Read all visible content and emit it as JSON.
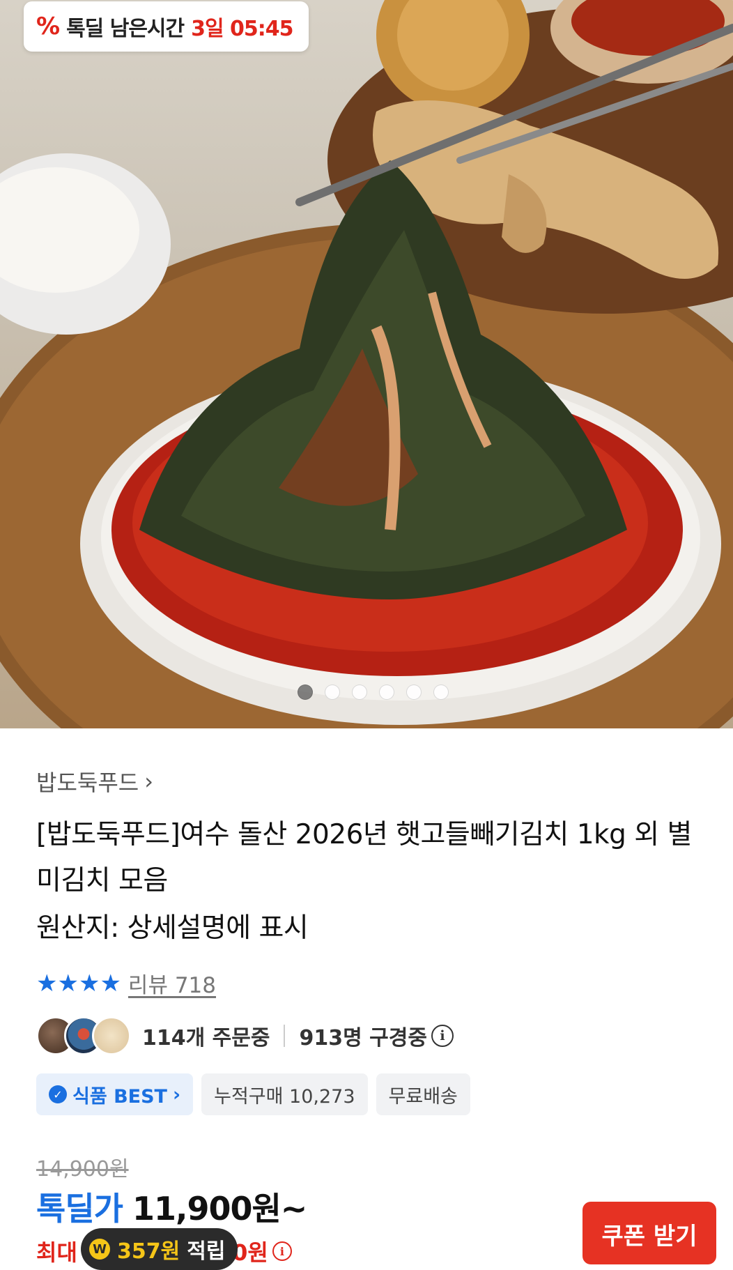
{
  "hero": {
    "timer": {
      "icon": "percent-tag-icon",
      "label": "톡딜 남은시간",
      "value": "3일 05:45"
    },
    "carousel": {
      "count": 6,
      "active": 0
    }
  },
  "product": {
    "seller": "밥도둑푸드",
    "title": "[밥도둑푸드]여수 돌산 2026년 햇고들빼기김치 1kg 외 별미김치 모음",
    "origin": "원산지: 상세설명에 표시",
    "rating": {
      "stars": 4,
      "review_text": "리뷰 718"
    },
    "social": {
      "orders": "114개 주문중",
      "viewers": "913명 구경중"
    },
    "badges": {
      "best": "식품 BEST",
      "cumulative": "누적구매 10,273",
      "shipping": "무료배송"
    },
    "price": {
      "original": "14,900원",
      "deal_label": "톡딜가",
      "deal_price": "11,900원~",
      "max_prefix": "최대",
      "max_suffix": "00원",
      "points": "357원",
      "points_label": "적립"
    },
    "coupon_button": "쿠폰 받기"
  },
  "colors": {
    "accent_blue": "#1a6fe0",
    "accent_red": "#e0251b",
    "coupon_red": "#e63223"
  }
}
